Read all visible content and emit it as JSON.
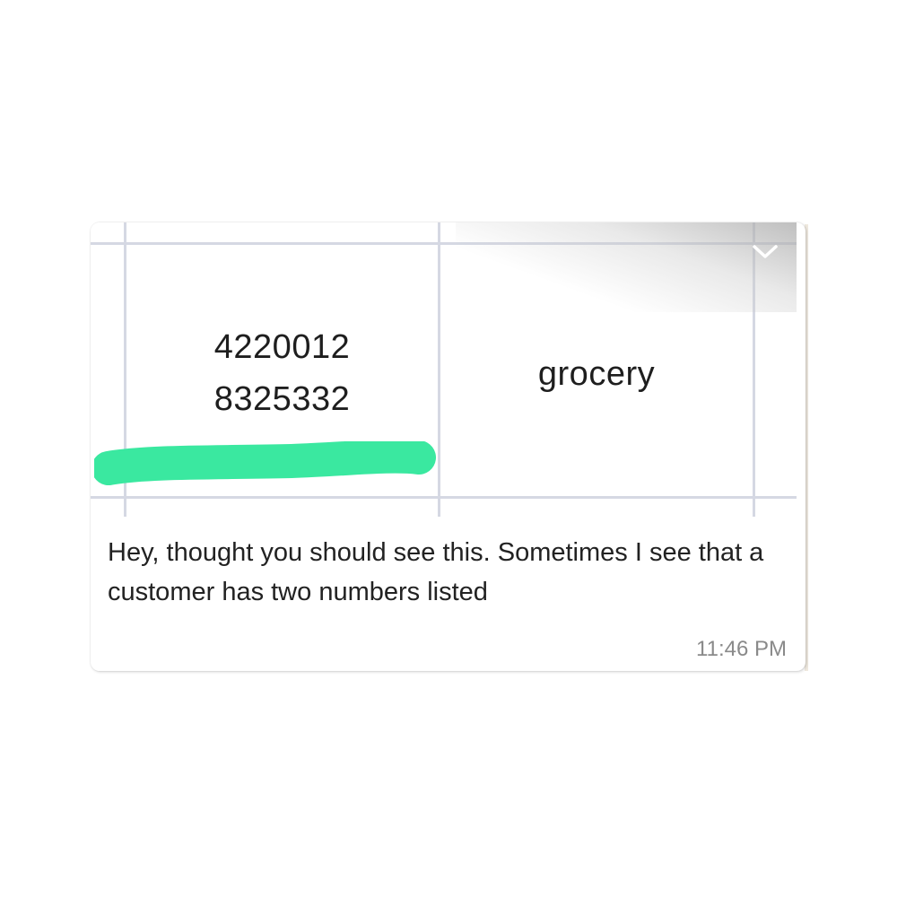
{
  "message": {
    "image": {
      "cells": {
        "numbers": [
          "4220012",
          "8325332"
        ],
        "category": "grocery"
      },
      "highlight_color": "#3ae8a0"
    },
    "text": "Hey, thought you should see this. Sometimes I see that a customer has two numbers listed",
    "timestamp": "11:46 PM",
    "menu_icon": "chevron-down-icon"
  }
}
